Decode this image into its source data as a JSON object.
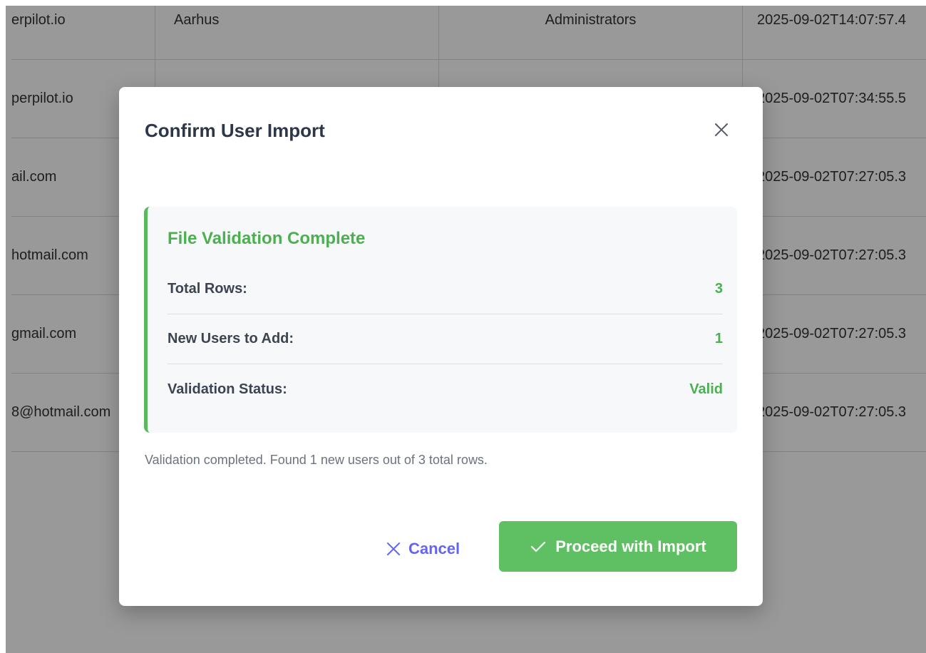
{
  "background_table": {
    "rows": [
      {
        "email": "erpilot.io",
        "city": "Aarhus",
        "group": "Administrators",
        "created": "2025-09-02T14:07:57.4"
      },
      {
        "email": "perpilot.io",
        "city": "",
        "group": "",
        "created": "2025-09-02T07:34:55.5"
      },
      {
        "email": "ail.com",
        "city": "",
        "group": "",
        "created": "2025-09-02T07:27:05.3"
      },
      {
        "email": "hotmail.com",
        "city": "",
        "group": "",
        "created": "2025-09-02T07:27:05.3"
      },
      {
        "email": "gmail.com",
        "city": "",
        "group": "",
        "created": "2025-09-02T07:27:05.3"
      },
      {
        "email": "8@hotmail.com",
        "city": "",
        "group": "",
        "created": "2025-09-02T07:27:05.3"
      }
    ]
  },
  "modal": {
    "title": "Confirm User Import",
    "close_icon": "close-icon",
    "panel": {
      "title": "File Validation Complete",
      "stats": [
        {
          "label": "Total Rows:",
          "value": "3"
        },
        {
          "label": "New Users to Add:",
          "value": "1"
        },
        {
          "label": "Validation Status:",
          "value": "Valid"
        }
      ]
    },
    "message": "Validation completed. Found 1 new users out of 3 total rows.",
    "cancel_label": "Cancel",
    "proceed_label": "Proceed with Import"
  },
  "colors": {
    "success": "#4caf50",
    "proceed_bg": "#5fc063",
    "cancel_text": "#6366f1"
  }
}
